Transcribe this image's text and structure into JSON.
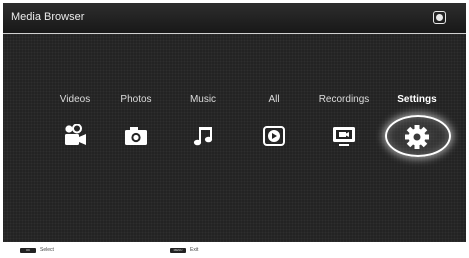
{
  "header": {
    "title": "Media Browser",
    "logo": "app-logo-icon"
  },
  "menu": {
    "items": [
      {
        "label": "Videos",
        "icon": "video-camera-icon"
      },
      {
        "label": "Photos",
        "icon": "camera-icon"
      },
      {
        "label": "Music",
        "icon": "music-note-icon"
      },
      {
        "label": "All",
        "icon": "play-icon"
      },
      {
        "label": "Recordings",
        "icon": "recording-tv-icon"
      },
      {
        "label": "Settings",
        "icon": "gear-icon"
      }
    ],
    "selected": "Settings"
  },
  "footer": {
    "hints": [
      {
        "key": "OK",
        "label": "Select"
      },
      {
        "key": "MENU",
        "label": "Exit"
      }
    ]
  }
}
